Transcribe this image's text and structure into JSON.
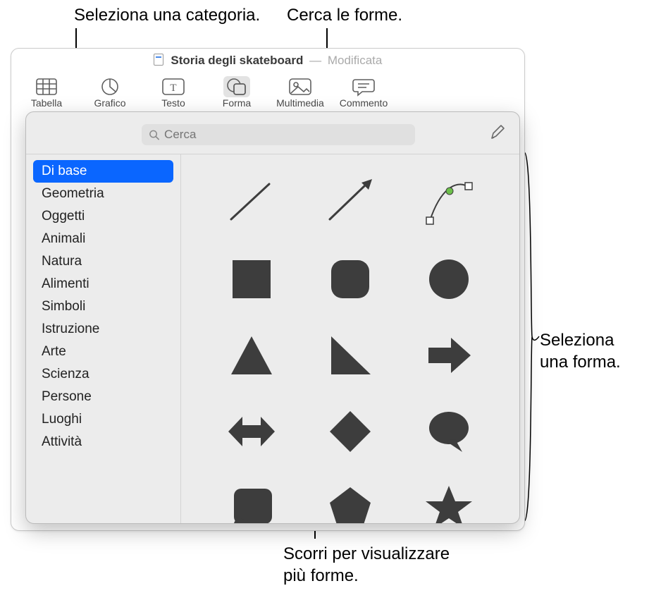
{
  "callouts": {
    "select_category": "Seleziona una categoria.",
    "search_shapes": "Cerca le forme.",
    "select_shape_l1": "Seleziona",
    "select_shape_l2": "una forma.",
    "scroll_more_l1": "Scorri per visualizzare",
    "scroll_more_l2": "più forme."
  },
  "title": {
    "document": "Storia degli skateboard",
    "modified": "Modificata"
  },
  "toolbar": {
    "table": "Tabella",
    "chart": "Grafico",
    "text": "Testo",
    "shape": "Forma",
    "media": "Multimedia",
    "comment": "Commento"
  },
  "search": {
    "placeholder": "Cerca"
  },
  "categories": [
    "Di base",
    "Geometria",
    "Oggetti",
    "Animali",
    "Natura",
    "Alimenti",
    "Simboli",
    "Istruzione",
    "Arte",
    "Scienza",
    "Persone",
    "Luoghi",
    "Attività"
  ],
  "selected_category_index": 0,
  "shapes": [
    "line",
    "arrow-line",
    "bezier-curve",
    "square",
    "rounded-square",
    "circle",
    "triangle",
    "right-triangle",
    "arrow-right",
    "arrow-bidir",
    "diamond",
    "speech-bubble",
    "callout-rect",
    "pentagon",
    "star"
  ]
}
